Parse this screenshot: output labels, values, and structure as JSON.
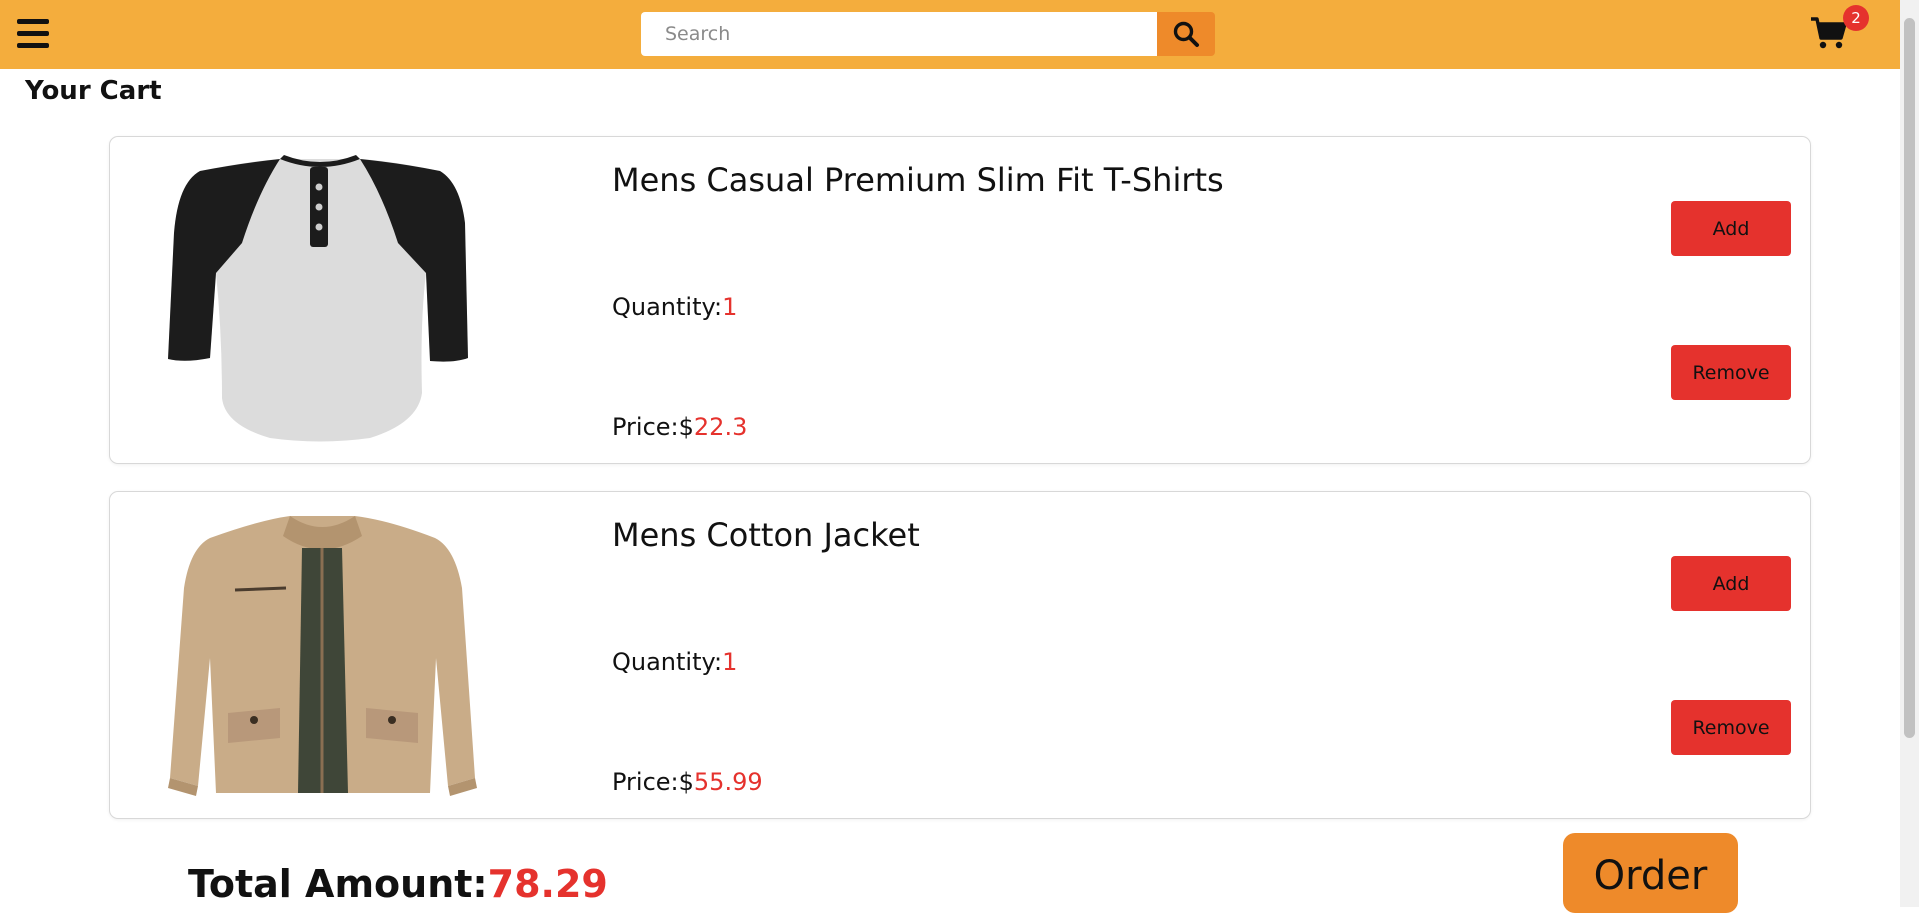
{
  "header": {
    "menu_icon": "hamburger-menu-icon",
    "search": {
      "placeholder": "Search",
      "value": "",
      "icon": "search-icon"
    },
    "cart": {
      "icon": "cart-icon",
      "count": "2"
    },
    "background_color": "#f4ad3d"
  },
  "page": {
    "title": "Your Cart"
  },
  "cart_items": [
    {
      "title": "Mens Casual Premium Slim Fit T-Shirts",
      "quantity_label": "Quantity:",
      "quantity": "1",
      "price_label": "Price:$",
      "price": "22.3",
      "add_label": "Add",
      "remove_label": "Remove",
      "image": "tshirt-raglan-image"
    },
    {
      "title": "Mens Cotton Jacket",
      "quantity_label": "Quantity:",
      "quantity": "1",
      "price_label": "Price:$",
      "price": "55.99",
      "add_label": "Add",
      "remove_label": "Remove",
      "image": "cotton-jacket-image"
    }
  ],
  "summary": {
    "total_label": "Total Amount:",
    "total_value": "78.29",
    "order_label": "Order"
  },
  "colors": {
    "accent_red": "#e5322d",
    "accent_orange": "#ee8a2a",
    "navbar": "#f4ad3d"
  }
}
